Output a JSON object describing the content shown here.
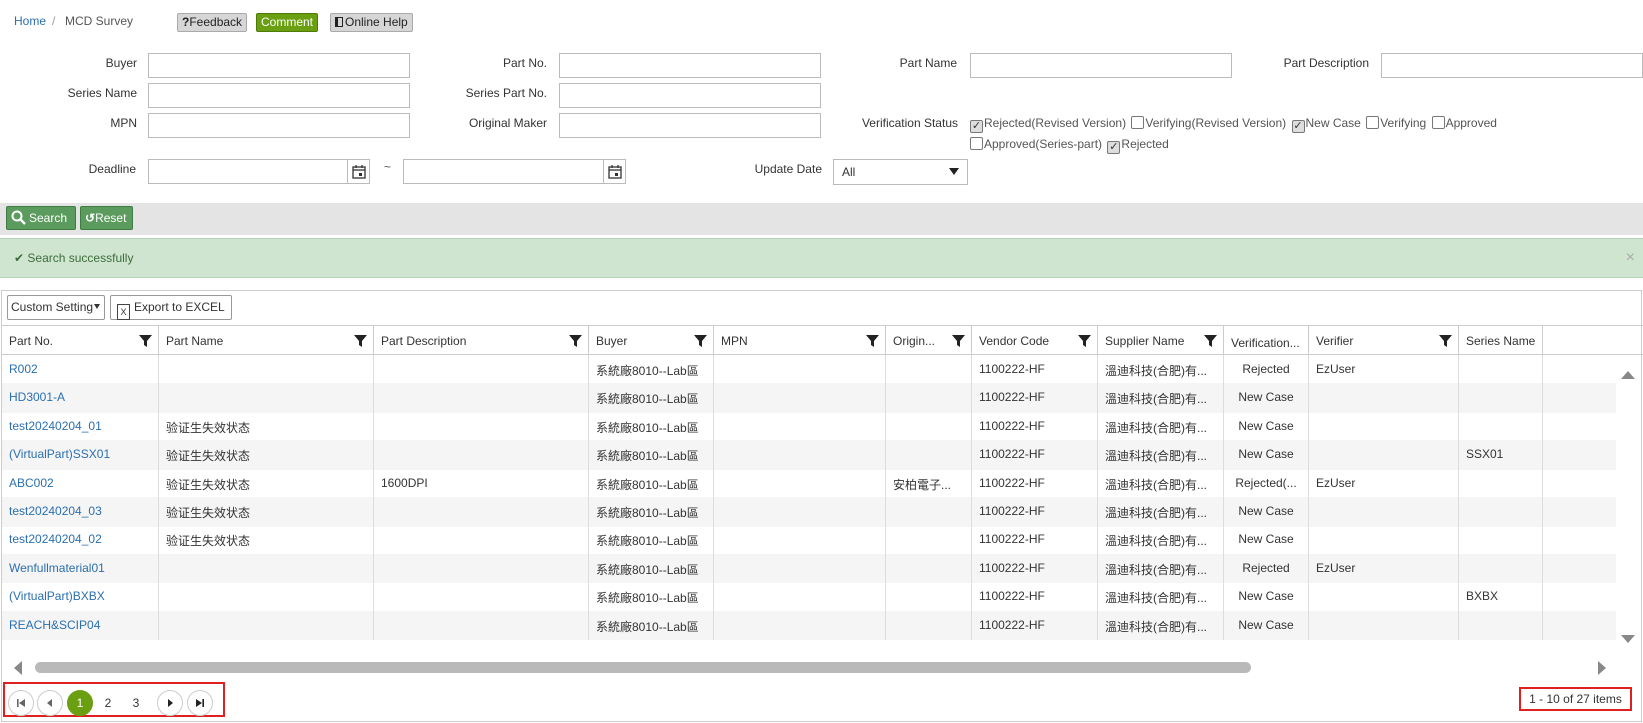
{
  "breadcrumb": {
    "home": "Home",
    "sep": "/",
    "current": "MCD Survey"
  },
  "toolbar": {
    "feedback": "Feedback",
    "feedback_prefix": "?",
    "comment": "Comment",
    "help": "Online Help"
  },
  "filters": {
    "buyer_label": "Buyer",
    "part_no_label": "Part No.",
    "part_name_label": "Part Name",
    "part_desc_label": "Part Description",
    "series_name_label": "Series Name",
    "series_part_no_label": "Series Part No.",
    "mpn_label": "MPN",
    "original_maker_label": "Original Maker",
    "verification_label": "Verification Status",
    "deadline_label": "Deadline",
    "deadline_sep": "~",
    "update_date_label": "Update Date",
    "update_date_value": "All",
    "statuses": [
      {
        "label": "Rejected(Revised Version)",
        "checked": true
      },
      {
        "label": "Verifying(Revised Version)",
        "checked": false
      },
      {
        "label": "New Case",
        "checked": true
      },
      {
        "label": "Verifying",
        "checked": false
      },
      {
        "label": "Approved",
        "checked": false
      },
      {
        "label": "Approved(Series-part)",
        "checked": false
      },
      {
        "label": "Rejected",
        "checked": true
      }
    ]
  },
  "actions": {
    "search": "Search",
    "reset": "Reset"
  },
  "message": {
    "text": "Search successfully",
    "close": "×"
  },
  "grid": {
    "custom_setting": "Custom Setting",
    "export": "Export to EXCEL",
    "columns": [
      "Part No.",
      "Part Name",
      "Part Description",
      "Buyer",
      "MPN",
      "Origin...",
      "Vendor Code",
      "Supplier Name",
      "Verification...",
      "Verifier",
      "Series Name"
    ],
    "rows": [
      [
        "R002",
        "",
        "",
        "系統廠8010--Lab區",
        "",
        "",
        "1100222-HF",
        "溫迪科技(合肥)有...",
        "Rejected",
        "EzUser",
        ""
      ],
      [
        "HD3001-A",
        "",
        "",
        "系統廠8010--Lab區",
        "",
        "",
        "1100222-HF",
        "溫迪科技(合肥)有...",
        "New Case",
        "",
        ""
      ],
      [
        "test20240204_01",
        "验证生失效状态",
        "",
        "系統廠8010--Lab區",
        "",
        "",
        "1100222-HF",
        "溫迪科技(合肥)有...",
        "New Case",
        "",
        ""
      ],
      [
        "(VirtualPart)SSX01",
        "验证生失效状态",
        "",
        "系統廠8010--Lab區",
        "",
        "",
        "1100222-HF",
        "溫迪科技(合肥)有...",
        "New Case",
        "",
        "SSX01"
      ],
      [
        "ABC002",
        "验证生失效状态",
        "1600DPI",
        "系統廠8010--Lab區",
        "",
        "安柏電子...",
        "1100222-HF",
        "溫迪科技(合肥)有...",
        "Rejected(...",
        "EzUser",
        ""
      ],
      [
        "test20240204_03",
        "验证生失效状态",
        "",
        "系統廠8010--Lab區",
        "",
        "",
        "1100222-HF",
        "溫迪科技(合肥)有...",
        "New Case",
        "",
        ""
      ],
      [
        "test20240204_02",
        "验证生失效状态",
        "",
        "系統廠8010--Lab區",
        "",
        "",
        "1100222-HF",
        "溫迪科技(合肥)有...",
        "New Case",
        "",
        ""
      ],
      [
        "Wenfullmaterial01",
        "",
        "",
        "系統廠8010--Lab區",
        "",
        "",
        "1100222-HF",
        "溫迪科技(合肥)有...",
        "Rejected",
        "EzUser",
        ""
      ],
      [
        "(VirtualPart)BXBX",
        "",
        "",
        "系統廠8010--Lab區",
        "",
        "",
        "1100222-HF",
        "溫迪科技(合肥)有...",
        "New Case",
        "",
        "BXBX"
      ],
      [
        "REACH&SCIP04",
        "",
        "",
        "系統廠8010--Lab區",
        "",
        "",
        "1100222-HF",
        "溫迪科技(合肥)有...",
        "New Case",
        "",
        ""
      ]
    ]
  },
  "pager": {
    "pages": [
      "1",
      "2",
      "3"
    ],
    "current": "1",
    "summary": "1 - 10 of 27 items"
  },
  "colors": {
    "accent": "#6a9f12",
    "search_btn": "#5b9b5e",
    "success_bg": "#cfe5cf",
    "link": "#2a6fb0",
    "highlight": "#e02020"
  }
}
